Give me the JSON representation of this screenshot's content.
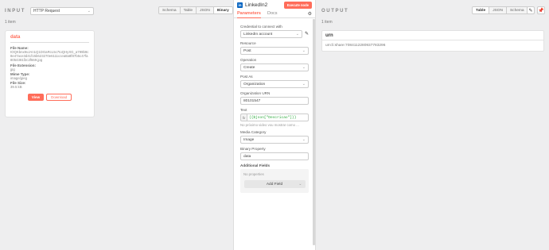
{
  "input": {
    "title": "INPUT",
    "node_select": "HTTP Request",
    "tabs": [
      "Schema",
      "Table",
      "JSON",
      "Binary"
    ],
    "active_tab": "Binary",
    "item_count": "1 item",
    "binary": {
      "key": "data",
      "file_name_label": "File Name:",
      "file_name": "tOQKbnx9vJAn1Q1DGaRcL5c7toQHyXG_a799b9c8e47ace3d41f15b623270e6111ccea8a8f87b5c47fa8054381f2c2f669.jpg",
      "file_ext_label": "File Extension:",
      "file_ext": "jpg",
      "mime_label": "Mime Type:",
      "mime": "image/jpeg",
      "size_label": "File Size:",
      "size": "39.5 kB",
      "view_label": "View",
      "download_label": "Download"
    }
  },
  "node": {
    "icon_letter": "in",
    "name": "LinkedIn2",
    "execute_label": "Execute node",
    "tabs": [
      "Parameters",
      "Docs"
    ],
    "credential_label": "Credential to connect with",
    "credential_value": "LinkedIn account",
    "resource_label": "Resource",
    "resource_value": "Post",
    "operation_label": "Operation",
    "operation_value": "Create",
    "post_as_label": "Post As",
    "post_as_value": "Organization",
    "org_urn_label": "Organization URN",
    "org_urn_value": "80101547",
    "text_label": "Text",
    "fx": "fx",
    "text_value": "{{$json[\"Descricao\"]}}",
    "text_hint": "No próximo video vou mostrar como ...",
    "media_label": "Media Category",
    "media_value": "Image",
    "binary_prop_label": "Binary Property",
    "binary_prop_value": "data",
    "additional_label": "Additional Fields",
    "no_props": "No properties",
    "add_field_label": "Add Field"
  },
  "output": {
    "title": "OUTPUT",
    "tabs": [
      "Table",
      "JSON",
      "Schema"
    ],
    "active_tab": "Table",
    "item_count": "1 item",
    "column": "urn",
    "value": "urn:li:share:7084112280937783296"
  },
  "icons": {
    "edit": "pencil-icon",
    "pin": "pin-icon",
    "settings": "gear-icon",
    "dropdown": "chevron-down-icon"
  },
  "colors": {
    "accent": "#ff6d5a",
    "linkedin": "#0a66c2",
    "expression": "#2aa93a"
  }
}
